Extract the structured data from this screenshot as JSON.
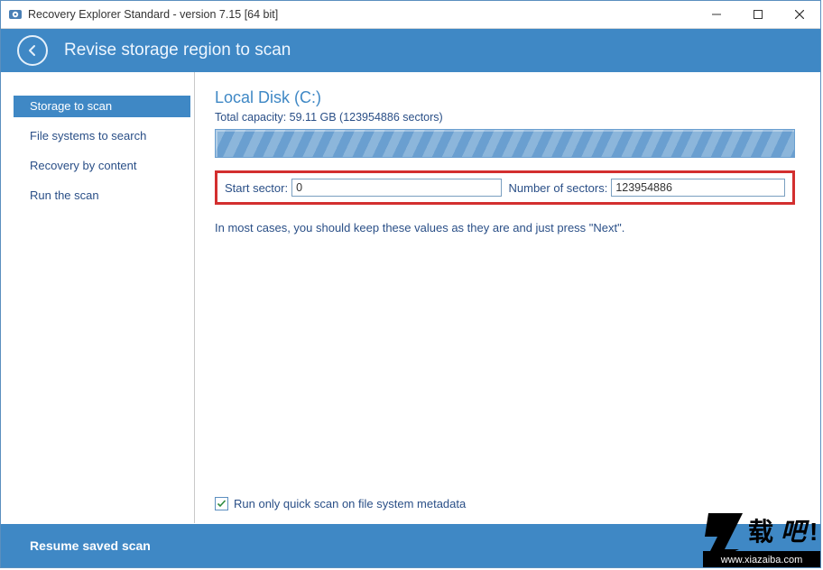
{
  "titlebar": {
    "title": "Recovery Explorer Standard - version 7.15 [64 bit]"
  },
  "header": {
    "title": "Revise storage region to scan"
  },
  "sidebar": {
    "items": [
      {
        "label": "Storage to scan",
        "selected": true
      },
      {
        "label": "File systems to search",
        "selected": false
      },
      {
        "label": "Recovery by content",
        "selected": false
      },
      {
        "label": "Run the scan",
        "selected": false
      }
    ]
  },
  "main": {
    "disk_title": "Local Disk (C:)",
    "capacity_text": "Total capacity: 59.11 GB (123954886 sectors)",
    "fields": {
      "start_sector_label": "Start sector:",
      "start_sector_value": "0",
      "num_sectors_label": "Number of sectors:",
      "num_sectors_value": "123954886"
    },
    "hint": "In most cases, you should keep these values as they are and just press \"Next\".",
    "quick_scan_label": "Run only quick scan on file system metadata",
    "quick_scan_checked": true
  },
  "footer": {
    "resume_label": "Resume saved scan"
  },
  "watermark": {
    "url_text": "www.xiazaiba.com"
  }
}
